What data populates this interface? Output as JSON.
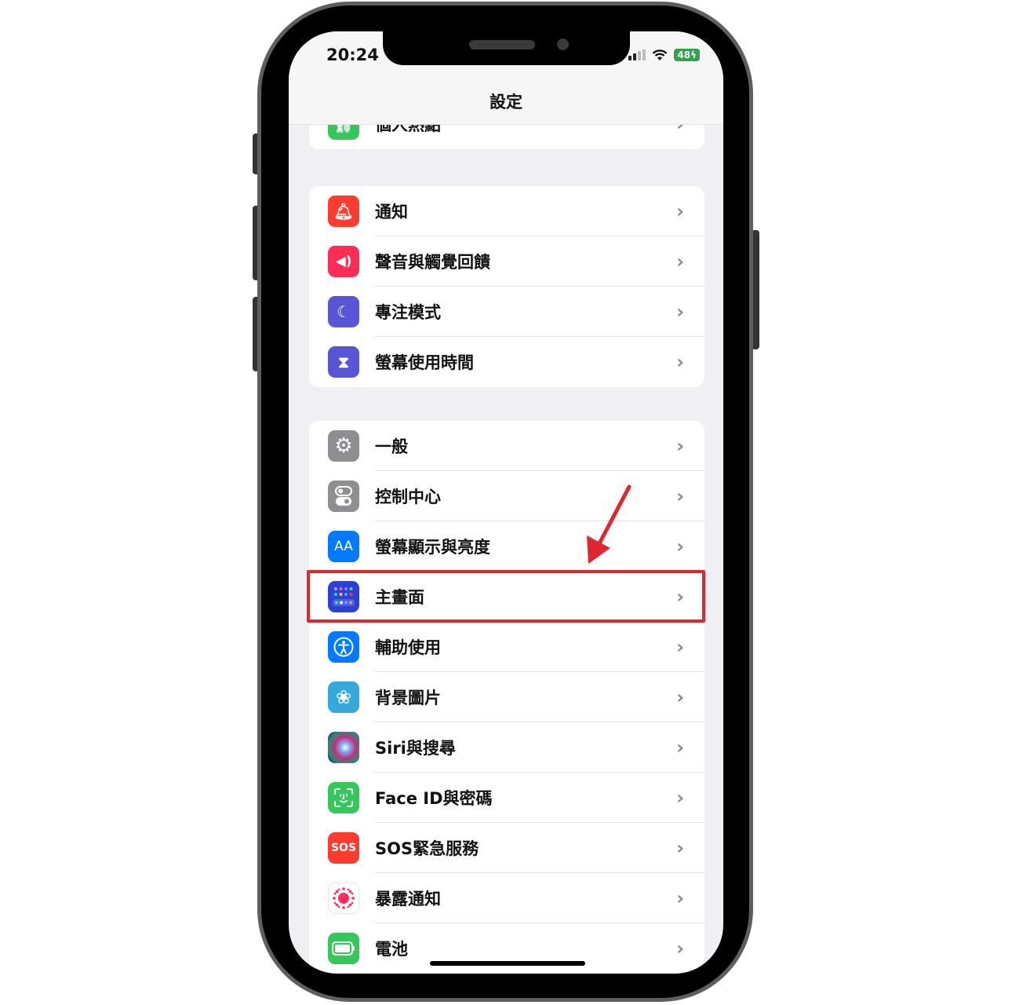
{
  "status_bar": {
    "time": "20:24",
    "battery": "48",
    "battery_charging_icon": "bolt-icon",
    "wifi_icon": "wifi-icon",
    "signal_icon": "cellular-signal-icon"
  },
  "nav": {
    "title": "設定"
  },
  "groups": [
    {
      "items": [
        {
          "label": "個人熱點",
          "icon": "personal-hotspot-icon",
          "color": "#34c759"
        }
      ]
    },
    {
      "items": [
        {
          "label": "通知",
          "icon": "bell-icon",
          "color": "#ff3b30"
        },
        {
          "label": "聲音與觸覺回饋",
          "icon": "speaker-icon",
          "color": "#ff2d55"
        },
        {
          "label": "專注模式",
          "icon": "moon-icon",
          "color": "#5856d6"
        },
        {
          "label": "螢幕使用時間",
          "icon": "hourglass-icon",
          "color": "#5856d6"
        }
      ]
    },
    {
      "items": [
        {
          "label": "一般",
          "icon": "gear-icon",
          "color": "#8e8e93"
        },
        {
          "label": "控制中心",
          "icon": "toggles-icon",
          "color": "#8e8e93"
        },
        {
          "label": "螢幕顯示與亮度",
          "icon": "text-size-icon",
          "color": "#007aff",
          "glyph": "AA"
        },
        {
          "label": "主畫面",
          "icon": "home-screen-icon",
          "color": "#2c3fd6",
          "highlighted": true
        },
        {
          "label": "輔助使用",
          "icon": "accessibility-icon",
          "color": "#007aff"
        },
        {
          "label": "背景圖片",
          "icon": "wallpaper-flower-icon",
          "color": "#34aadc"
        },
        {
          "label": "Siri與搜尋",
          "icon": "siri-icon",
          "color": "#2a2a3a"
        },
        {
          "label": "Face ID與密碼",
          "icon": "face-id-icon",
          "color": "#34c759"
        },
        {
          "label": "SOS緊急服務",
          "icon": "sos-icon",
          "color": "#ff3b30",
          "glyph": "SOS"
        },
        {
          "label": "暴露通知",
          "icon": "exposure-notification-icon",
          "color": "#ffffff"
        },
        {
          "label": "電池",
          "icon": "battery-icon",
          "color": "#34c759"
        }
      ]
    }
  ],
  "annotation": {
    "highlight_target": "主畫面",
    "highlight_color": "#e0262e"
  }
}
